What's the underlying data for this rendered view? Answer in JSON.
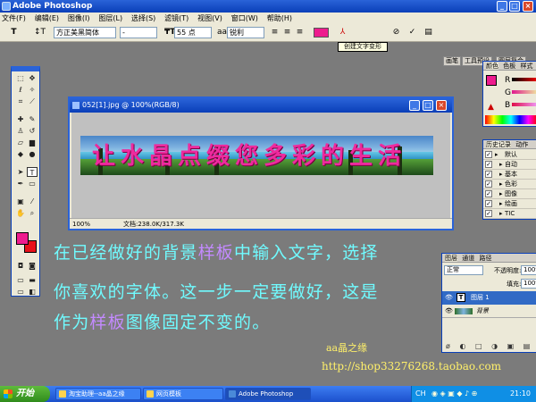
{
  "app": {
    "title": "Adobe Photoshop"
  },
  "menu": [
    "文件(F)",
    "编辑(E)",
    "图像(I)",
    "图层(L)",
    "选择(S)",
    "滤镜(T)",
    "视图(V)",
    "窗口(W)",
    "帮助(H)"
  ],
  "options": {
    "font_family": "方正美黑简体",
    "font_style": "-",
    "font_size": "55 点",
    "antialias": "锐利",
    "warp_tooltip": "创建文字变形",
    "text_color": "#ee1c8e"
  },
  "well_tabs": [
    "画笔",
    "工具预设",
    "图层复合"
  ],
  "document": {
    "title": "052[1].jpg @ 100%(RGB/8)",
    "banner_text": "让水晶点缀您多彩的生活",
    "zoom": "100%",
    "doc_size": "文档:238.0K/317.3K"
  },
  "colors": {
    "foreground": "#ee1c8e",
    "background": "#e8101a"
  },
  "color_panel": {
    "tabs": [
      "颜色",
      "色板",
      "样式"
    ],
    "channels": [
      "R",
      "G",
      "B"
    ]
  },
  "history_panel": {
    "tabs": [
      "历史记录",
      "动作"
    ],
    "items": [
      "默认",
      "自动",
      "基本",
      "色彩",
      "图像",
      "绘画",
      "TIC"
    ]
  },
  "layers_panel": {
    "tabs": [
      "图层",
      "通道",
      "路径"
    ],
    "blend_mode": "正常",
    "opacity_label": "不透明度:",
    "opacity_value": "100%",
    "fill_label": "填充:",
    "fill_value": "100%",
    "layers": [
      {
        "name": "图层 1",
        "type": "text"
      },
      {
        "name": "背景",
        "type": "image"
      }
    ]
  },
  "instructions": {
    "line1_pre": "在已经做好的背景",
    "line1_hl": "样板",
    "line1_post": "中输入文字，选择",
    "line2": "你喜欢的字体。这一步一定要做好，这是",
    "line3_pre": "作为",
    "line3_hl": "样板",
    "line3_post": "图像固定不变的。",
    "credit": "aa晶之缘",
    "url": "http://shop33276268.taobao.com"
  },
  "taskbar": {
    "start": "开始",
    "tasks": [
      "淘宝助理--aa晶之缘",
      "网页模板",
      "Adobe Photoshop"
    ],
    "lang": "CH",
    "time": "21:10"
  }
}
